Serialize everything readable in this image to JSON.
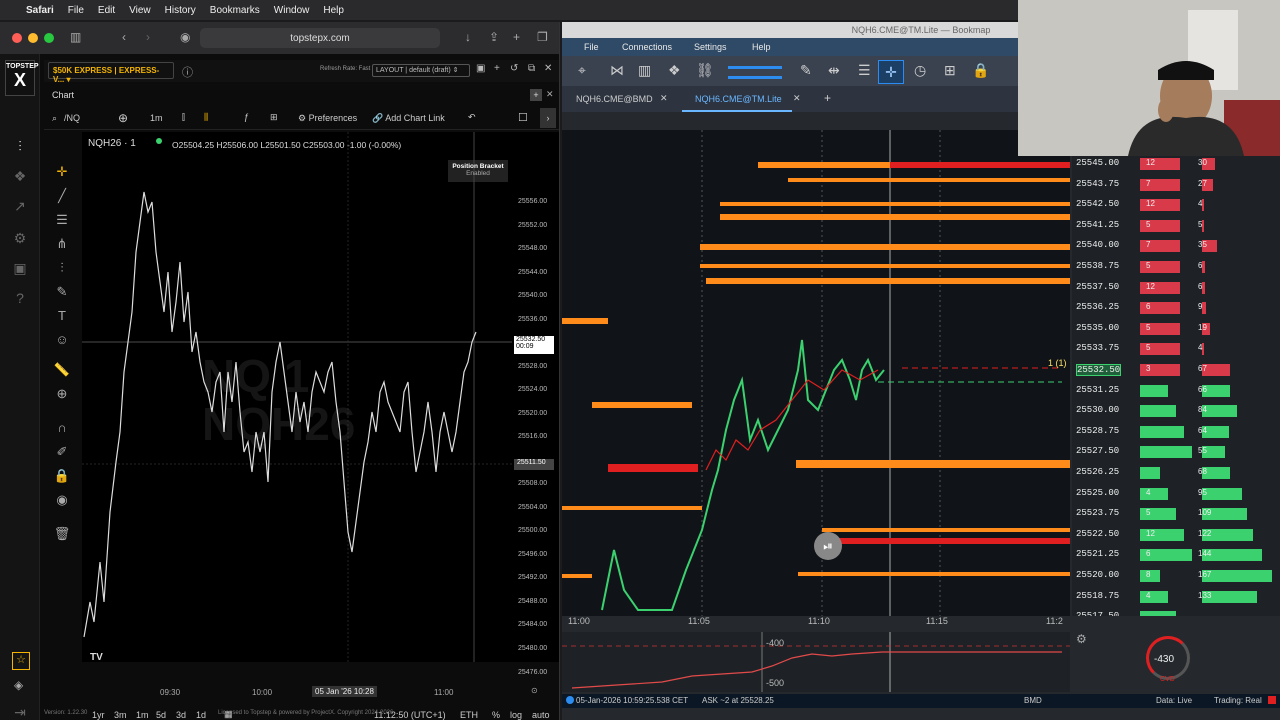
{
  "menubar": {
    "app": "Safari",
    "items": [
      "File",
      "Edit",
      "View",
      "History",
      "Bookmarks",
      "Window",
      "Help"
    ]
  },
  "safari": {
    "url": "topstepx.com"
  },
  "topstep": {
    "logo_top": "TOPSTEP",
    "logo_x": "X",
    "account": "$50K EXPRESS | EXPRESS-V...",
    "refresh_rate": "Refresh Rate: Fast",
    "layout": "LAYOUT | default (draft)",
    "chart_tab": "Chart",
    "symbol_search": "/NQ",
    "timeframe": "1m",
    "preferences": "Preferences",
    "add_chart_link": "Add Chart Link",
    "symbol": "NQH26 · 1",
    "ohlc": "O25504.25 H25506.00 L25501.50 C25503.00 -1.00 (-0.00%)",
    "position_bracket": "Position Bracket",
    "position_bracket_state": "Enabled",
    "watermark_line1": "NQ 1",
    "watermark_line2": "NQH26",
    "current_price": "25532.50",
    "countdown": "00:09",
    "crosshair_price": "25511.50",
    "price_ticks": [
      "25556.00",
      "25552.00",
      "25548.00",
      "25544.00",
      "25540.00",
      "25536.00",
      "25532.00",
      "25528.00",
      "25524.00",
      "25520.00",
      "25516.00",
      "25512.00",
      "25508.00",
      "25504.00",
      "25500.00",
      "25496.00",
      "25492.00",
      "25488.00",
      "25484.00",
      "25480.00",
      "25476.00"
    ],
    "time_ticks": [
      "09:30",
      "10:00",
      "05 Jan '26",
      "10:28",
      "11:00"
    ],
    "ranges": [
      "1yr",
      "3m",
      "1m",
      "5d",
      "3d",
      "1d"
    ],
    "clock": "11:12:50 (UTC+1)",
    "session": "ETH",
    "pct": "%",
    "log": "log",
    "auto": "auto",
    "version": "Version: 1.22.30",
    "license": "Licensed to Topstep & powered by ProjectX. Copyright 2024-2026"
  },
  "bookmap": {
    "title": "NQH6.CME@TM.Lite",
    "app_name": "Bookmap",
    "menu": [
      "File",
      "Connections",
      "Settings",
      "Help"
    ],
    "tabs": [
      {
        "label": "NQH6.CME@BMD"
      },
      {
        "label": "NQH6.CME@TM.Lite"
      }
    ],
    "ladder": [
      {
        "price": "25545.00",
        "vol": "12",
        "vol2": "30"
      },
      {
        "price": "25543.75",
        "vol": "7",
        "vol2": "27"
      },
      {
        "price": "25542.50",
        "vol": "12",
        "vol2": "4"
      },
      {
        "price": "25541.25",
        "vol": "5",
        "vol2": "5"
      },
      {
        "price": "25540.00",
        "vol": "7",
        "vol2": "35"
      },
      {
        "price": "25538.75",
        "vol": "5",
        "vol2": "6"
      },
      {
        "price": "25537.50",
        "vol": "12",
        "vol2": "6"
      },
      {
        "price": "25536.25",
        "vol": "6",
        "vol2": "9"
      },
      {
        "price": "25535.00",
        "vol": "5",
        "vol2": "19"
      },
      {
        "price": "25533.75",
        "vol": "5",
        "vol2": "4"
      },
      {
        "price": "25532.50",
        "vol": "3",
        "vol2": "67"
      },
      {
        "price": "25531.25",
        "vol": "",
        "vol2": "66"
      },
      {
        "price": "25530.00",
        "vol": "",
        "vol2": "84"
      },
      {
        "price": "25528.75",
        "vol": "",
        "vol2": "64"
      },
      {
        "price": "25527.50",
        "vol": "",
        "vol2": "55"
      },
      {
        "price": "25526.25",
        "vol": "",
        "vol2": "68"
      },
      {
        "price": "25525.00",
        "vol": "4",
        "vol2": "95"
      },
      {
        "price": "25523.75",
        "vol": "5",
        "vol2": "109"
      },
      {
        "price": "25522.50",
        "vol": "12",
        "vol2": "122"
      },
      {
        "price": "25521.25",
        "vol": "6",
        "vol2": "144"
      },
      {
        "price": "25520.00",
        "vol": "8",
        "vol2": "167"
      },
      {
        "price": "25518.75",
        "vol": "4",
        "vol2": "133"
      },
      {
        "price": "25517.50",
        "vol": "",
        "vol2": ""
      }
    ],
    "position_marker": "1 (1)",
    "time_ticks": [
      "11:00",
      "11:05",
      "11:10",
      "11:15",
      "11:2"
    ],
    "cvd_ticks": [
      "-400",
      "-500"
    ],
    "cvd_value": "-430",
    "cvd_label": "CVD",
    "status_time": "05-Jan-2026 10:59:25.538 CET",
    "status_ask": "ASK ~2 at 25528.25",
    "status_src": "BMD",
    "data_live": "Data: Live",
    "trading": "Trading: Real"
  },
  "colors": {
    "accent_yellow": "#f4b400",
    "heat_orange": "#ff8c1a",
    "heat_red": "#e02020",
    "bid_green": "#3bd16f",
    "ask_red": "#d93a4a",
    "link_blue": "#6ab7ff"
  }
}
